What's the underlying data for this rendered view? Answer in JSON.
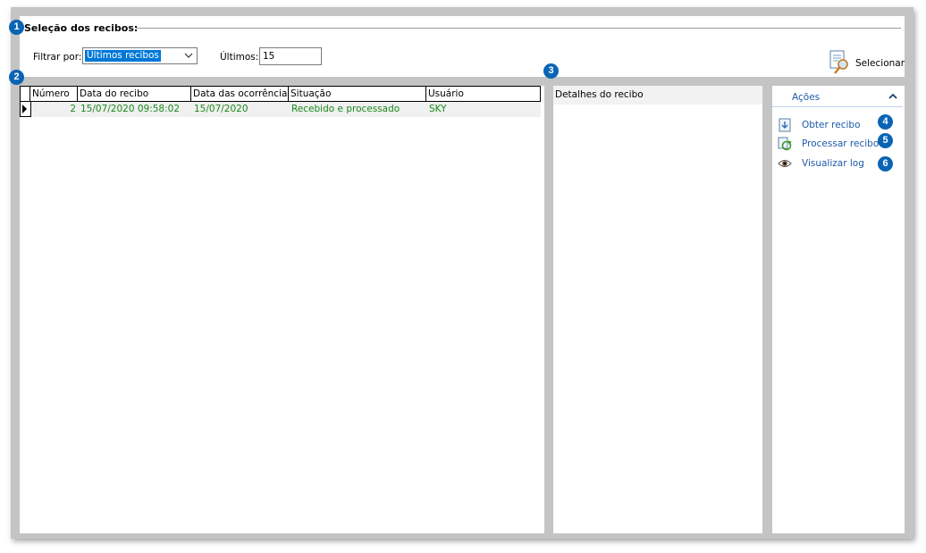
{
  "selection": {
    "title": "Seleção dos recibos:",
    "filter_label": "Filtrar por:",
    "filter_value": "Últimos recibos",
    "last_label": "Últimos:",
    "last_value": "15",
    "select_button": "Selecionar"
  },
  "grid": {
    "columns": [
      "Número",
      "Data do recibo",
      "Data das ocorrências",
      "Situação",
      "Usuário"
    ],
    "rows": [
      {
        "numero": "2",
        "data_recibo": "15/07/2020 09:58:02",
        "data_ocorrencias": "15/07/2020",
        "situacao": "Recebido e processado",
        "usuario": "SKY"
      }
    ]
  },
  "details": {
    "title": "Detalhes do recibo"
  },
  "actions": {
    "title": "Ações",
    "items": [
      {
        "label": "Obter recibo",
        "icon": "download-document-icon"
      },
      {
        "label": "Processar recibo",
        "icon": "process-refresh-icon"
      },
      {
        "label": "Visualizar log",
        "icon": "eye-icon"
      }
    ]
  },
  "badges": [
    "1",
    "2",
    "3",
    "4",
    "5",
    "6"
  ],
  "colors": {
    "accent": "#0a64b4",
    "link": "#1f5aa8",
    "row_text": "#1a8a1a",
    "selection": "#0078d7"
  }
}
